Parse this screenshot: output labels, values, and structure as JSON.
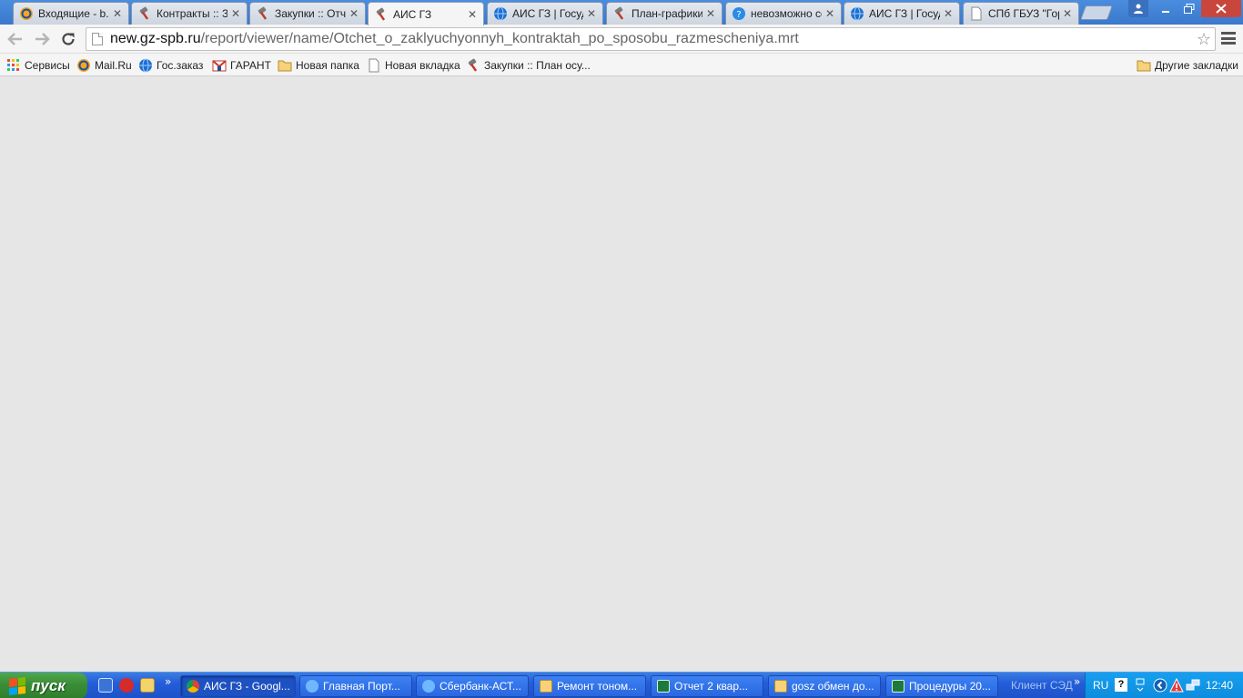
{
  "browser": {
    "tabs": [
      {
        "title": "Входящие - b.s",
        "icon": "mail-ru-icon",
        "active": false
      },
      {
        "title": "Контракты :: За",
        "icon": "gavel-icon",
        "active": false
      },
      {
        "title": "Закупки :: Отч",
        "icon": "gavel-icon",
        "active": false
      },
      {
        "title": "АИС ГЗ",
        "icon": "gavel-icon",
        "active": true
      },
      {
        "title": "АИС ГЗ | Госуд",
        "icon": "globe-icon",
        "active": false
      },
      {
        "title": "План-графики",
        "icon": "gavel-icon",
        "active": false
      },
      {
        "title": "невозможно сф",
        "icon": "help-globe-icon",
        "active": false
      },
      {
        "title": "АИС ГЗ | Госуд",
        "icon": "globe-icon",
        "active": false
      },
      {
        "title": "СПб ГБУЗ \"Гори",
        "icon": "page-icon",
        "active": false
      }
    ],
    "tab_close_glyph": "✕"
  },
  "toolbar": {
    "url_host": "new.gz-spb.ru",
    "url_path": "/report/viewer/name/Otchet_o_zaklyuchyonnyh_kontraktah_po_sposobu_razmescheniya.mrt"
  },
  "bookmarks": {
    "items": [
      {
        "label": "Сервисы",
        "icon": "apps-grid-icon"
      },
      {
        "label": "Mail.Ru",
        "icon": "mail-ru-icon"
      },
      {
        "label": "Гос.заказ",
        "icon": "globe-icon"
      },
      {
        "label": "ГАРАНТ",
        "icon": "garant-icon"
      },
      {
        "label": "Новая папка",
        "icon": "folder-icon"
      },
      {
        "label": "Новая вкладка",
        "icon": "page-icon"
      },
      {
        "label": "Закупки :: План осу...",
        "icon": "gavel-icon"
      }
    ],
    "other_label": "Другие закладки"
  },
  "taskbar": {
    "start_label": "пуск",
    "tasks": [
      {
        "label": "АИС ГЗ - Googl...",
        "icon": "chrome-icon",
        "active": true
      },
      {
        "label": "Главная Порт...",
        "icon": "ie-icon",
        "active": false
      },
      {
        "label": "Сбербанк-АСТ...",
        "icon": "ie-icon",
        "active": false
      },
      {
        "label": "Ремонт тоном...",
        "icon": "folder-icon",
        "active": false
      },
      {
        "label": "Отчет 2 квар...",
        "icon": "excel-icon",
        "active": false
      },
      {
        "label": "gosz обмен до...",
        "icon": "folder-search-icon",
        "active": false
      },
      {
        "label": "Процедуры 20...",
        "icon": "excel-icon",
        "active": false
      }
    ],
    "tray_label": "Клиент СЭД",
    "lang": "RU",
    "help_glyph": "?",
    "clock": "12:40"
  },
  "colors": {
    "content_bg": "#e6e6e6",
    "tab_strip": "#3a78cc",
    "taskbar": "#245edb",
    "start": "#3a8d37",
    "tray": "#0f8bdc"
  }
}
